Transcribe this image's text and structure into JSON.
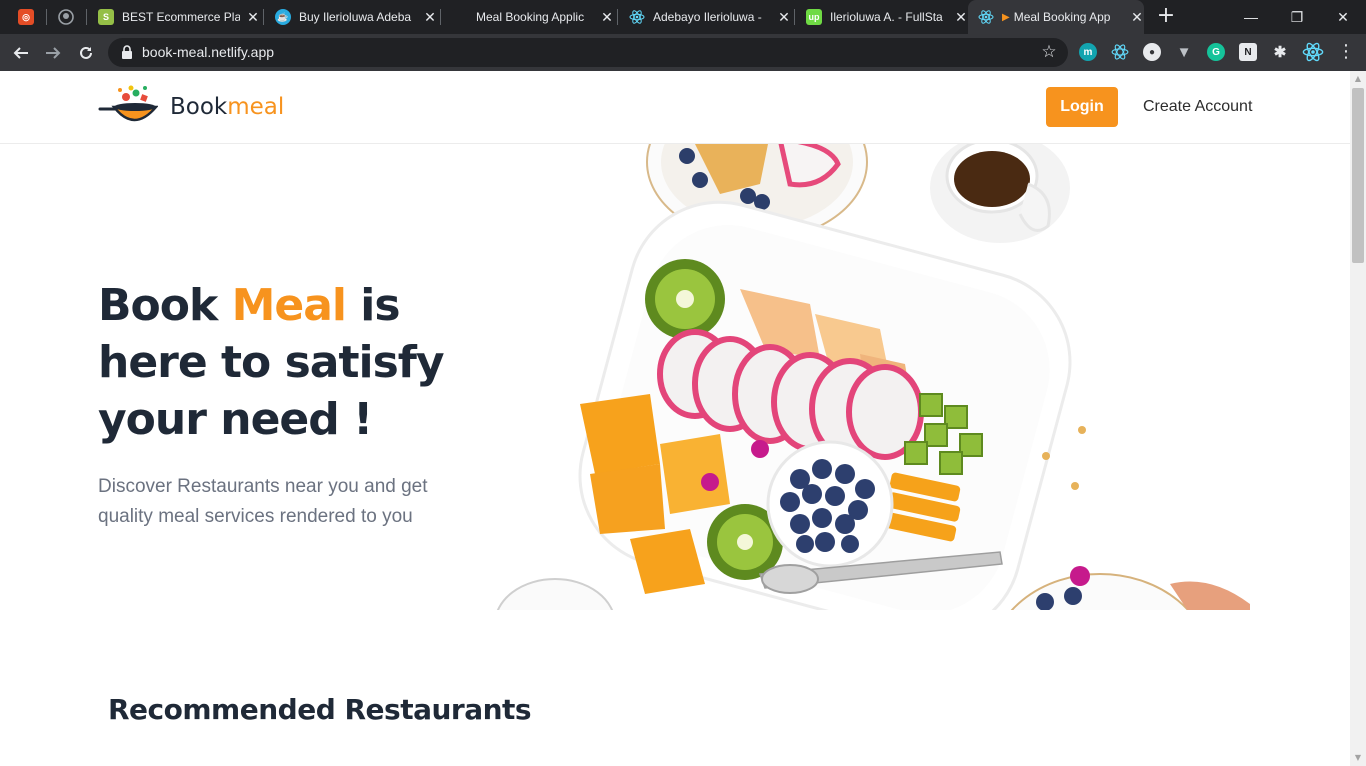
{
  "browser": {
    "tabs": [
      {
        "title": "",
        "icon": "app-icon"
      },
      {
        "title": "",
        "icon": "github-icon"
      },
      {
        "title": "BEST Ecommerce Plat",
        "icon": "shopify-icon"
      },
      {
        "title": "Buy Ilerioluwa Adeba",
        "icon": "coffee-icon"
      },
      {
        "title": "Meal Booking Applic",
        "icon": "meal-icon"
      },
      {
        "title": "Adebayo Ilerioluwa -",
        "icon": "react-icon"
      },
      {
        "title": "Ilerioluwa A. - FullSta",
        "icon": "upwork-icon"
      },
      {
        "title": "Meal Booking App",
        "icon": "react-icon",
        "active": true
      }
    ],
    "url": "book-meal.netlify.app",
    "window_controls": {
      "minimize": "—",
      "restore": "❐",
      "close": "✕"
    }
  },
  "site": {
    "brand": {
      "part1": "Book",
      "part2": "meal"
    },
    "nav": {
      "login_label": "Login",
      "create_account_label": "Create Account"
    },
    "hero": {
      "title_part1": "Book ",
      "title_accent": "Meal",
      "title_part2": " is here to satisfy your need !",
      "subtitle": "Discover Restaurants near you and get quality meal services rendered to you"
    },
    "recommended_title": "Recommended Restaurants"
  },
  "colors": {
    "accent": "#f7931e",
    "text_dark": "#1f2937",
    "muted": "#6b7280",
    "chrome_dark": "#202124",
    "chrome_toolbar": "#35363a"
  }
}
